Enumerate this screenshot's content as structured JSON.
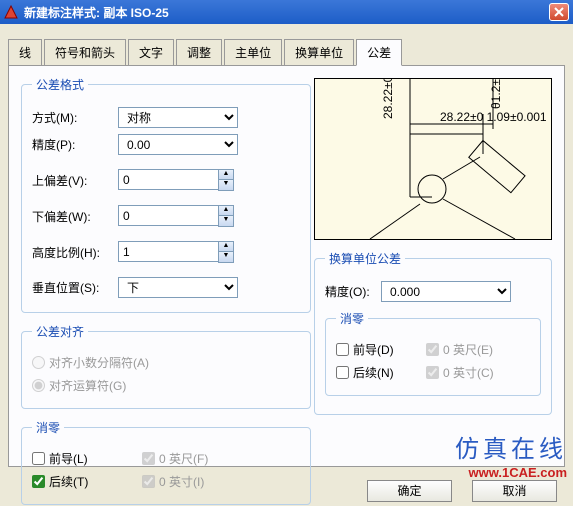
{
  "window": {
    "title": "新建标注样式: 副本 ISO-25"
  },
  "tabs": [
    "线",
    "符号和箭头",
    "文字",
    "调整",
    "主单位",
    "换算单位",
    "公差"
  ],
  "format": {
    "legend": "公差格式",
    "method_lbl": "方式(M):",
    "method_val": "对称",
    "precision_lbl": "精度(P):",
    "precision_val": "0.00",
    "upper_lbl": "上偏差(V):",
    "upper_val": "0",
    "lower_lbl": "下偏差(W):",
    "lower_val": "0",
    "height_lbl": "高度比例(H):",
    "height_val": "1",
    "vpos_lbl": "垂直位置(S):",
    "vpos_val": "下"
  },
  "align": {
    "legend": "公差对齐",
    "dec_sep": "对齐小数分隔符(A)",
    "op_sym": "对齐运算符(G)"
  },
  "zero1": {
    "legend": "消零",
    "leading": "前导(L)",
    "trailing": "后续(T)",
    "feet": "0 英尺(F)",
    "inch": "0 英寸(I)"
  },
  "alt": {
    "legend": "换算单位公差",
    "precision_lbl": "精度(O):",
    "precision_val": "0.000"
  },
  "zero2": {
    "legend": "消零",
    "leading": "前导(D)",
    "trailing": "后续(N)",
    "feet": "0 英尺(E)",
    "inch": "0 英寸(C)"
  },
  "buttons": {
    "ok": "确定",
    "cancel": "取消"
  },
  "watermark": {
    "line1": "仿真在线",
    "line2": "www.1CAE.com"
  }
}
